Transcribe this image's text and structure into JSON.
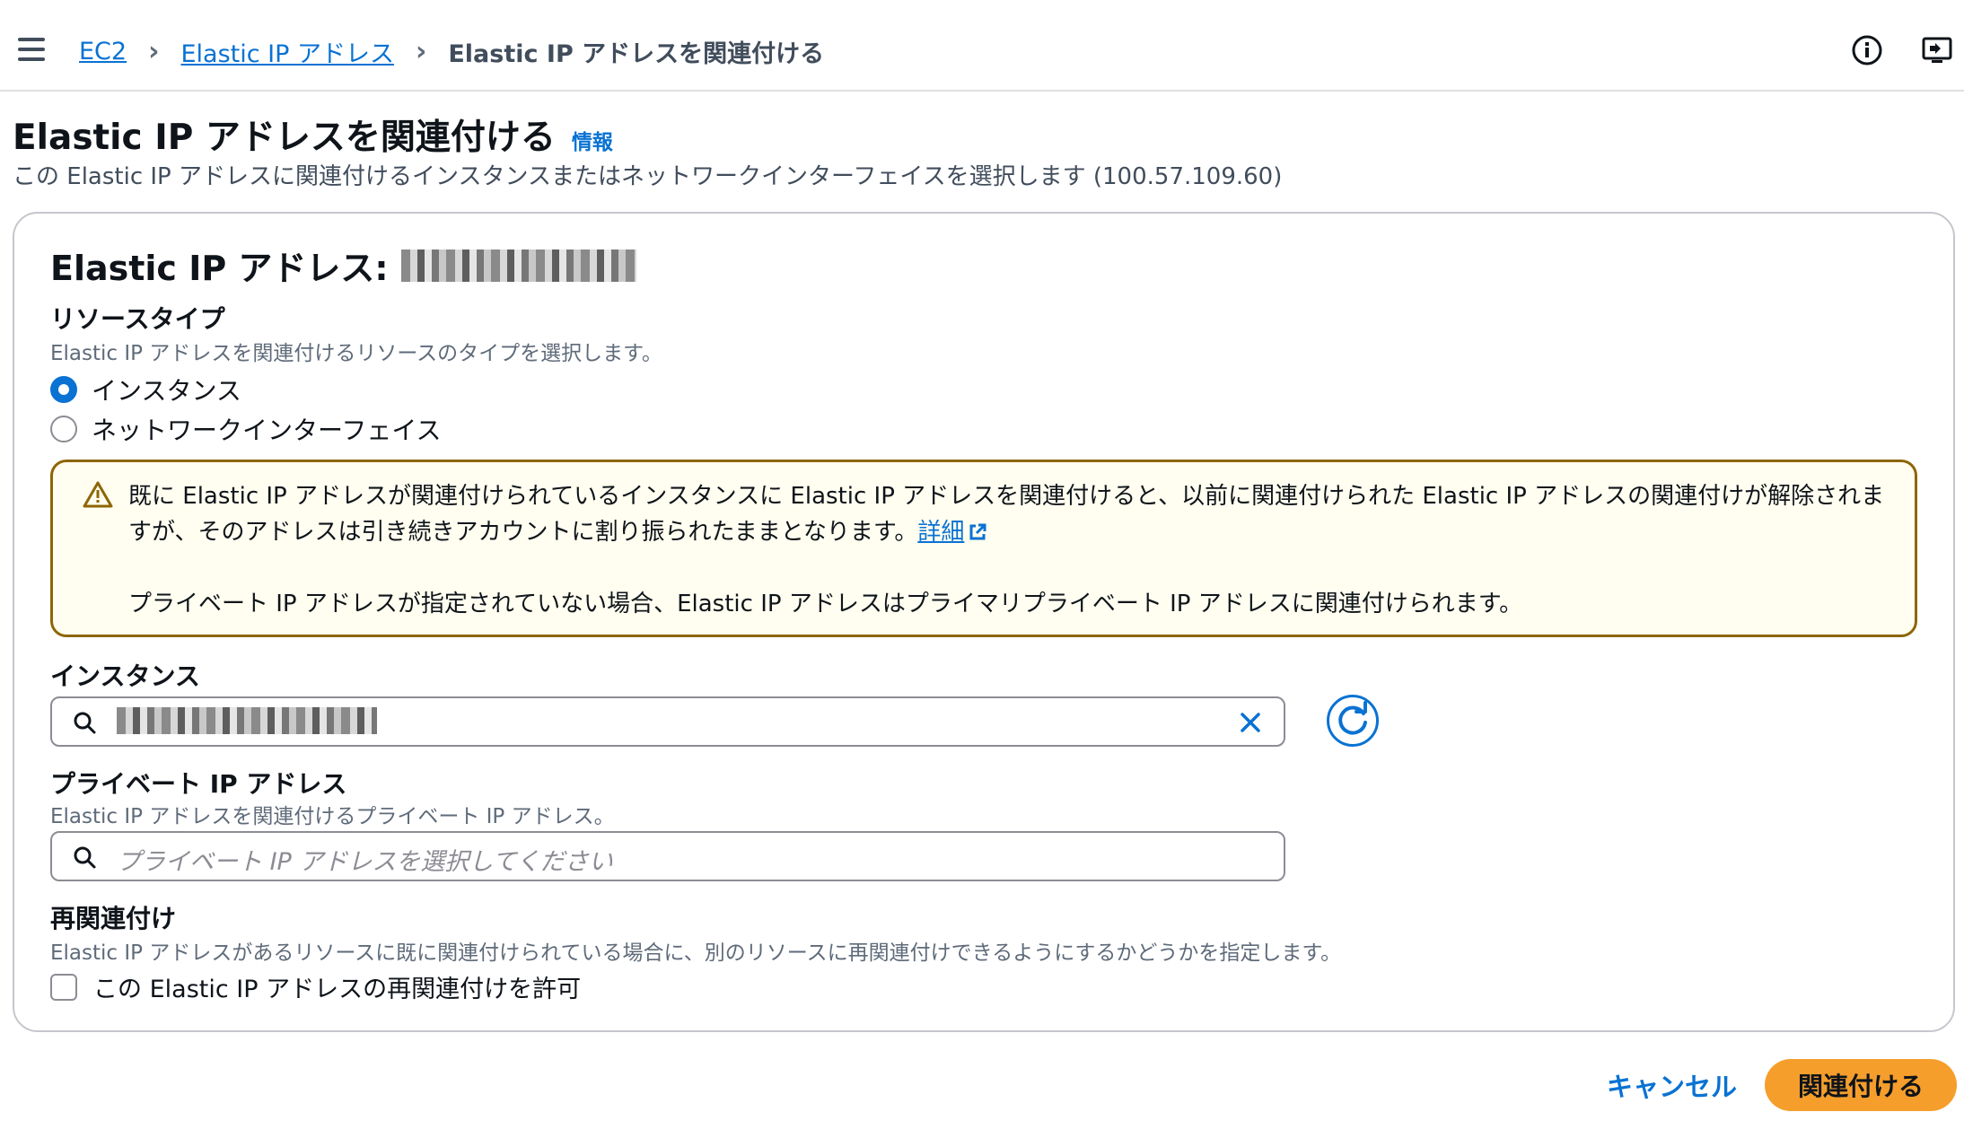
{
  "breadcrumb": {
    "items": [
      "EC2",
      "Elastic IP アドレス"
    ],
    "current": "Elastic IP アドレスを関連付ける"
  },
  "header": {
    "title": "Elastic IP アドレスを関連付ける",
    "info_link": "情報",
    "description": "この Elastic IP アドレスに関連付けるインスタンスまたはネットワークインターフェイスを選択します (100.57.109.60)"
  },
  "card": {
    "title": "Elastic IP アドレス:",
    "resource_type": {
      "label": "リソースタイプ",
      "description": "Elastic IP アドレスを関連付けるリソースのタイプを選択します。",
      "options": [
        {
          "label": "インスタンス",
          "checked": true
        },
        {
          "label": "ネットワークインターフェイス",
          "checked": false
        }
      ]
    },
    "alert": {
      "line1": "既に Elastic IP アドレスが関連付けられているインスタンスに Elastic IP アドレスを関連付けると、以前に関連付けられた Elastic IP アドレスの関連付けが解除されますが、そのアドレスは引き続きアカウントに割り振られたままとなります。",
      "link": "詳細",
      "line2": "プライベート IP アドレスが指定されていない場合、Elastic IP アドレスはプライマリプライベート IP アドレスに関連付けられます。"
    },
    "instance": {
      "label": "インスタンス"
    },
    "private_ip": {
      "label": "プライベート IP アドレス",
      "description": "Elastic IP アドレスを関連付けるプライベート IP アドレス。",
      "placeholder": "プライベート IP アドレスを選択してください"
    },
    "reassociation": {
      "label": "再関連付け",
      "description": "Elastic IP アドレスがあるリソースに既に関連付けられている場合に、別のリソースに再関連付けできるようにするかどうかを指定します。",
      "checkbox_label": "この Elastic IP アドレスの再関連付けを許可",
      "checked": false
    }
  },
  "actions": {
    "cancel": "キャンセル",
    "submit": "関連付ける"
  },
  "colors": {
    "link": "#0972d3",
    "primary_button": "#f59e2b",
    "warning_border": "#8d6605",
    "warning_bg": "#fffef0"
  }
}
